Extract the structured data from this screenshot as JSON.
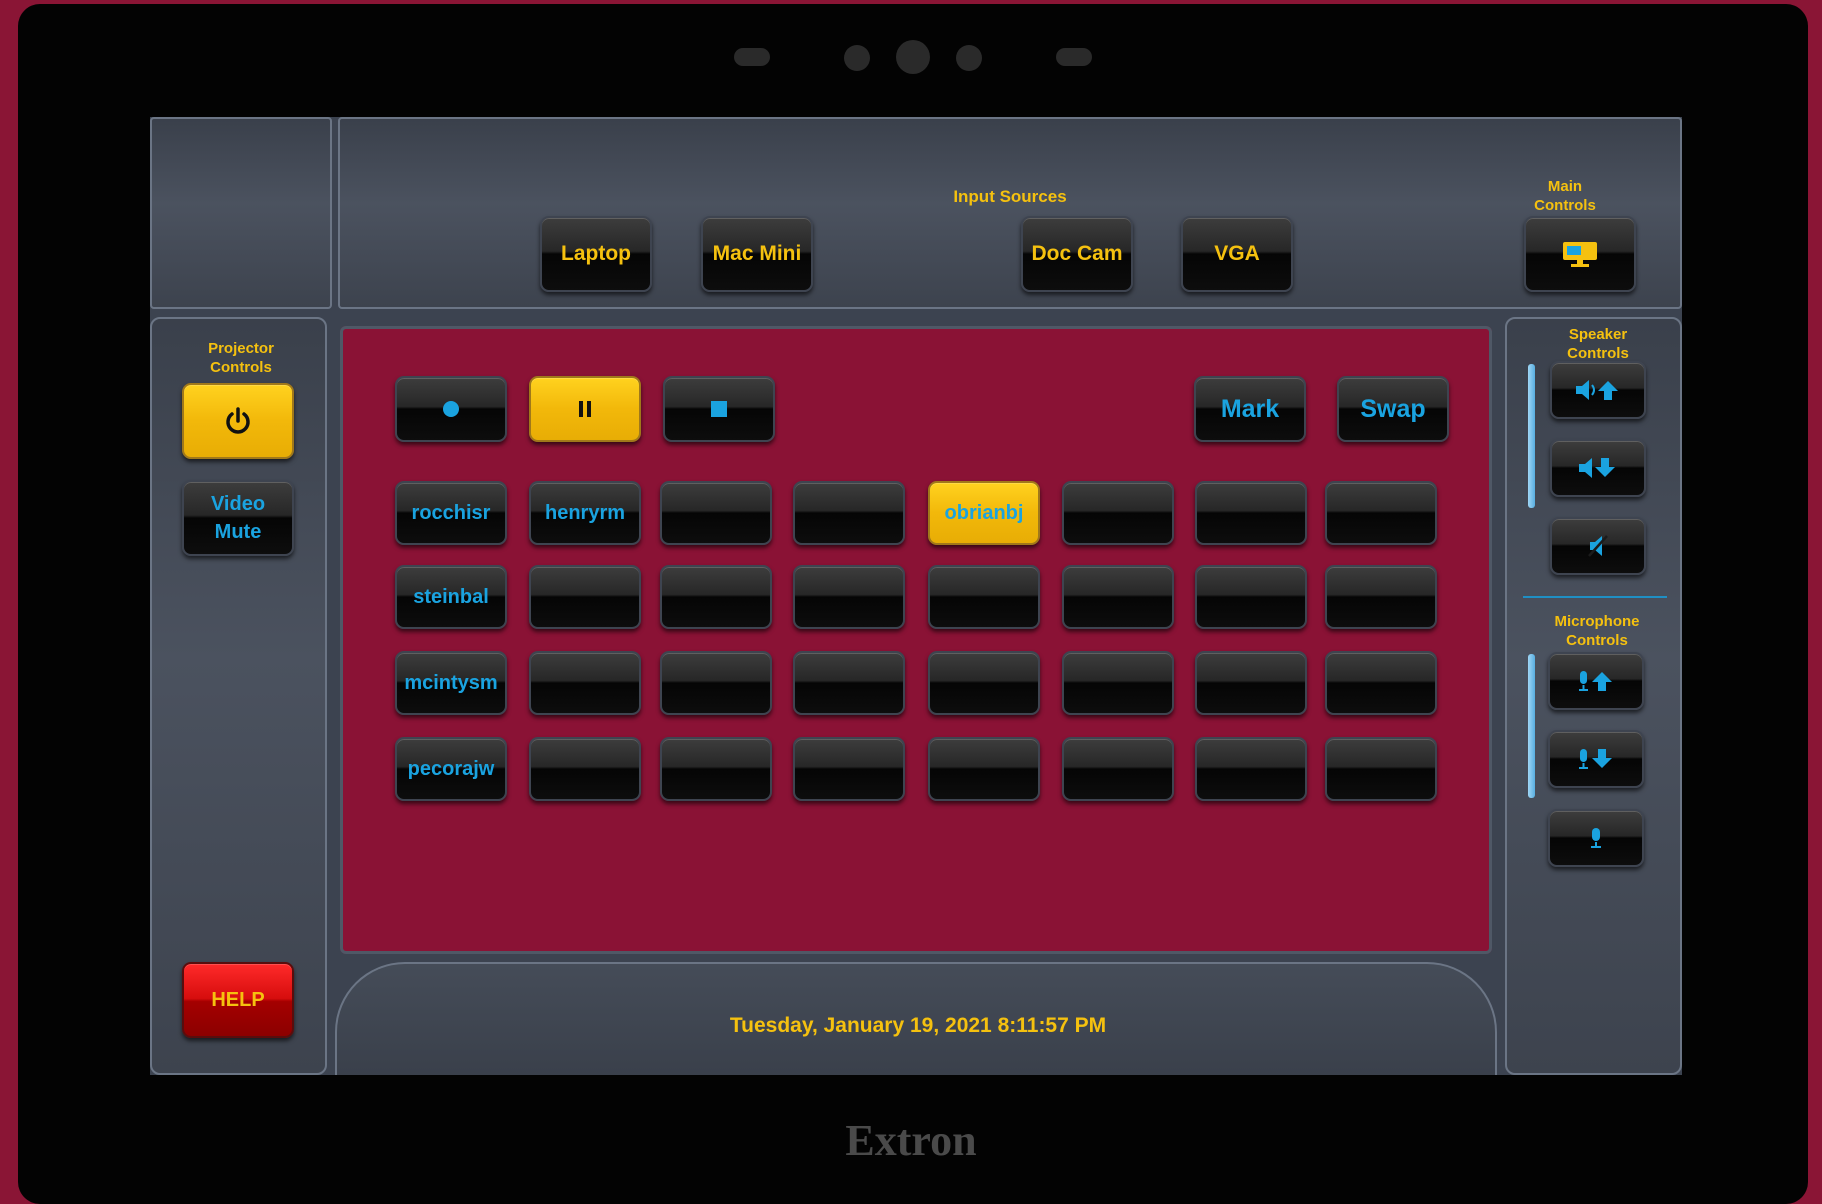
{
  "brand": "Extron",
  "header": {
    "input_sources_label": "Input Sources",
    "main_controls_label": "Main Controls",
    "sources": [
      "Laptop",
      "Mac Mini",
      "Doc Cam",
      "VGA"
    ]
  },
  "left_panel": {
    "projector_label": "Projector Controls",
    "video_mute_line1": "Video",
    "video_mute_line2": "Mute",
    "help_label": "HELP"
  },
  "transport": {
    "record_icon": "record-icon",
    "pause_icon": "pause-icon",
    "stop_icon": "stop-icon",
    "pause_active": true,
    "mark_label": "Mark",
    "swap_label": "Swap"
  },
  "grid": {
    "rows": [
      [
        "rocchisr",
        "henryrm",
        "",
        "",
        "obrianbj",
        "",
        "",
        ""
      ],
      [
        "steinbal",
        "",
        "",
        "",
        "",
        "",
        "",
        ""
      ],
      [
        "mcintysm",
        "",
        "",
        "",
        "",
        "",
        "",
        ""
      ],
      [
        "pecorajw",
        "",
        "",
        "",
        "",
        "",
        "",
        ""
      ]
    ],
    "selected": "obrianbj"
  },
  "right_panel": {
    "speaker_label": "Speaker Controls",
    "microphone_label": "Microphone Controls",
    "speaker_icons": [
      "volume-up-icon",
      "volume-down-icon",
      "volume-mute-icon"
    ],
    "mic_icons": [
      "mic-up-icon",
      "mic-down-icon",
      "mic-mute-icon"
    ]
  },
  "status": {
    "datetime": "Tuesday, January 19, 2021 8:11:57 PM"
  },
  "colors": {
    "accent_yellow": "#f5c10f",
    "accent_blue": "#1aa3e0",
    "background_maroon": "#8a1535",
    "help_red": "#d60d0d"
  }
}
